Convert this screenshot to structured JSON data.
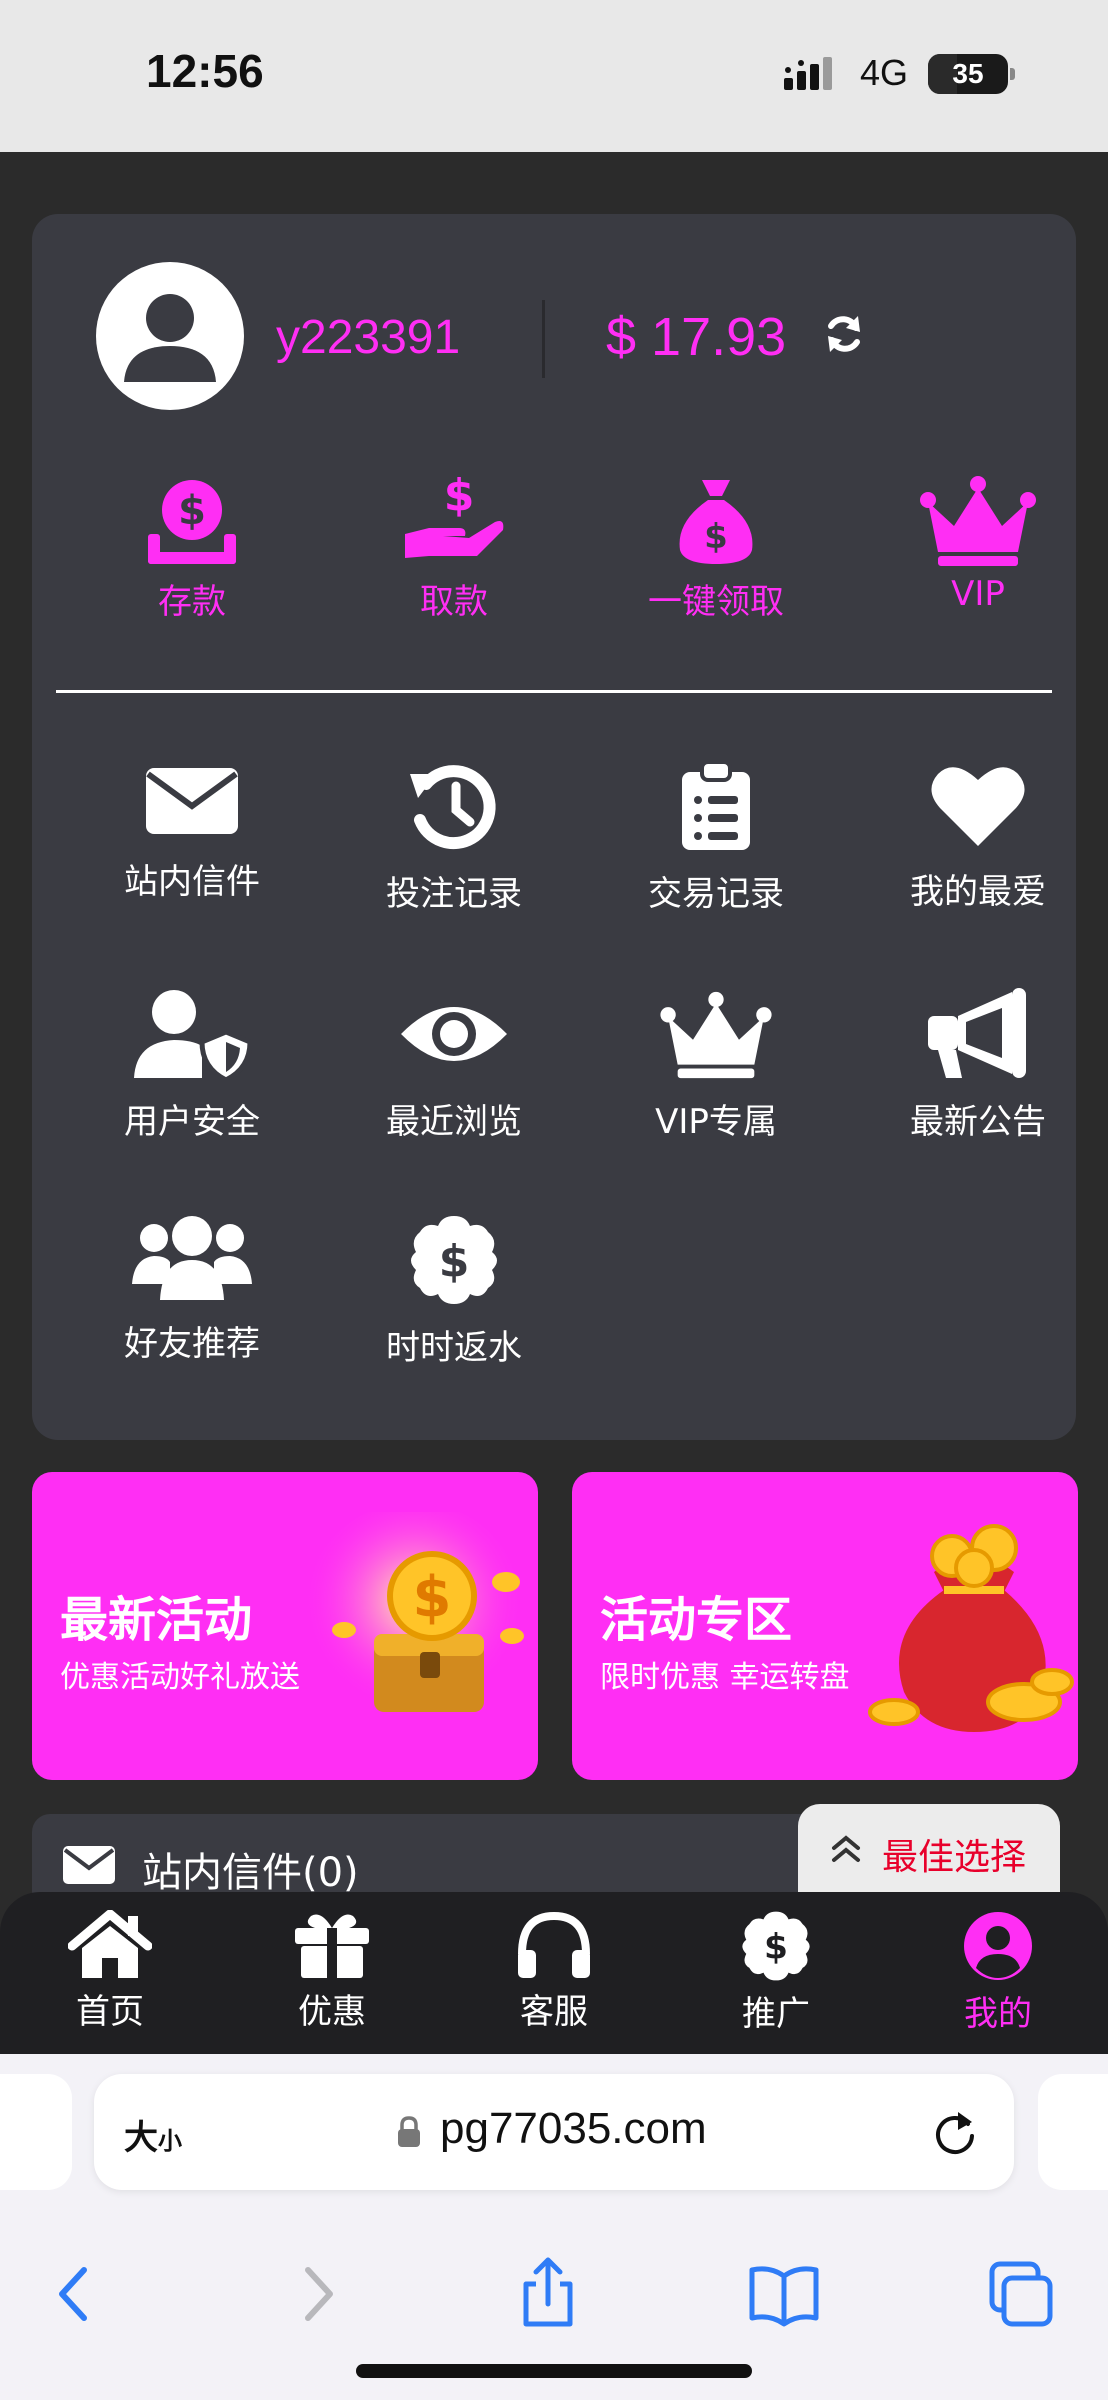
{
  "status_bar": {
    "time": "12:56",
    "network": "4G",
    "battery_level": "35"
  },
  "account": {
    "username": "y223391",
    "balance": "$ 17.93"
  },
  "quick_actions": [
    {
      "label": "存款",
      "icon": "deposit-icon"
    },
    {
      "label": "取款",
      "icon": "withdraw-icon"
    },
    {
      "label": "一键领取",
      "icon": "money-bag-icon"
    },
    {
      "label": "VIP",
      "icon": "crown-icon"
    }
  ],
  "menu": [
    {
      "label": "站内信件",
      "icon": "envelope-icon"
    },
    {
      "label": "投注记录",
      "icon": "history-icon"
    },
    {
      "label": "交易记录",
      "icon": "clipboard-icon"
    },
    {
      "label": "我的最爱",
      "icon": "heart-icon"
    },
    {
      "label": "用户安全",
      "icon": "user-shield-icon"
    },
    {
      "label": "最近浏览",
      "icon": "eye-icon"
    },
    {
      "label": "VIP专属",
      "icon": "crown-icon"
    },
    {
      "label": "最新公告",
      "icon": "megaphone-icon"
    },
    {
      "label": "好友推荐",
      "icon": "users-icon"
    },
    {
      "label": "时时返水",
      "icon": "dollar-badge-icon"
    }
  ],
  "promos": [
    {
      "title": "最新活动",
      "subtitle": "优惠活动好礼放送",
      "art": "gold-coin-chest-icon"
    },
    {
      "title": "活动专区",
      "subtitle": "限时优惠 幸运转盘",
      "art": "coin-bag-icon"
    }
  ],
  "mail_strip": {
    "label": "站内信件(0)"
  },
  "best_choice": {
    "label": "最佳选择"
  },
  "bottom_nav": [
    {
      "label": "首页",
      "icon": "home-icon"
    },
    {
      "label": "优惠",
      "icon": "gift-icon"
    },
    {
      "label": "客服",
      "icon": "headset-icon"
    },
    {
      "label": "推广",
      "icon": "dollar-badge-icon"
    },
    {
      "label": "我的",
      "icon": "user-circle-icon",
      "active": true
    }
  ],
  "browser": {
    "text_size_label": "大",
    "text_size_small": "小",
    "url": "pg77035.com"
  },
  "colors": {
    "accent": "#ff2ef4",
    "card_bg": "#3a3b42",
    "page_bg": "#2b2b2b",
    "best_choice_text": "#e8002b"
  }
}
